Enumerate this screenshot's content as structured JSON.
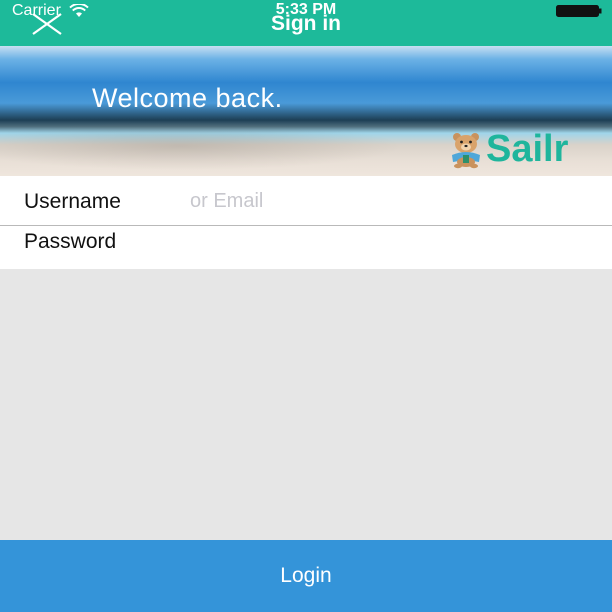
{
  "status_bar": {
    "carrier": "Carrier",
    "time": "5:33 PM"
  },
  "nav": {
    "title": "Sign in",
    "close_icon": "close-icon"
  },
  "hero": {
    "welcome": "Welcome back.",
    "logo_text": "Sailr"
  },
  "form": {
    "username_label": "Username",
    "username_placeholder": "or Email",
    "username_value": "",
    "password_label": "Password",
    "password_value": ""
  },
  "login_button": {
    "label": "Login"
  },
  "colors": {
    "header": "#1dba9a",
    "login": "#3494d9",
    "background": "#e6e6e6",
    "logo": "#1fb59c"
  }
}
